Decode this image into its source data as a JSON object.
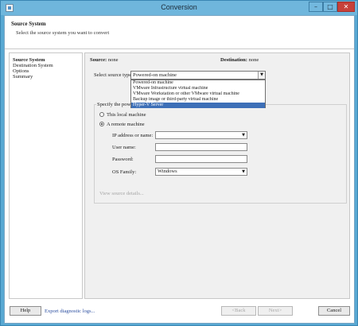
{
  "window": {
    "title": "Conversion",
    "minimize": "–",
    "maximize": "□",
    "close": "✕"
  },
  "header": {
    "title": "Source System",
    "subtitle": "Select the source system you want to convert"
  },
  "nav": {
    "items": [
      "Source System",
      "Destination System",
      "Options",
      "Summary"
    ]
  },
  "main": {
    "source_label": "Source:",
    "source_value": "none",
    "destination_label": "Destination:",
    "destination_value": "none",
    "select_type_label": "Select source type:",
    "select_type_value": "Powered-on machine",
    "options": [
      "Powered-on machine",
      "VMware Infrastructure virtual machine",
      "VMware Workstation or other VMware virtual machine",
      "Backup image or third-party virtual machine",
      "Hyper-V Server"
    ],
    "highlighted_option": "Hyper-V Server",
    "group_legend": "Specify the powe",
    "radio_local": "This local machine",
    "radio_remote": "A remote machine",
    "ip_label": "IP address or name:",
    "ip_value": "",
    "username_label": "User name:",
    "username_value": "",
    "password_label": "Password:",
    "password_value": "",
    "os_label": "OS Family:",
    "os_value": "Windows",
    "view_details": "View source details..."
  },
  "footer": {
    "help": "Help",
    "export": "Export diagnostic logs...",
    "back": "<Back",
    "next": "Next>",
    "cancel": "Cancel"
  }
}
